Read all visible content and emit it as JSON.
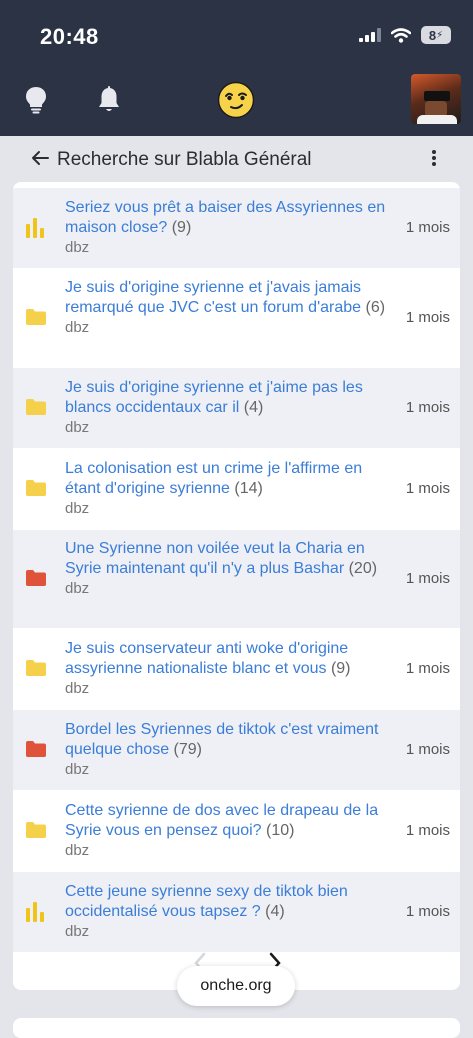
{
  "status_bar": {
    "time": "20:48",
    "battery": "8"
  },
  "app_bar": {
    "icons": [
      "lightbulb-icon",
      "bell-icon",
      "smiley-logo-icon",
      "avatar"
    ]
  },
  "header": {
    "title": "Recherche sur Blabla Général"
  },
  "topics": [
    {
      "title": "Seriez vous prêt a baiser des Assyriennes en maison close?",
      "count": "(9)",
      "author": "dbz",
      "age": "1 mois",
      "icon": "poll-icon",
      "color": "#f0c419"
    },
    {
      "title": "Je suis d'origine syrienne et j'avais jamais remarqué que JVC c'est un forum d'arabe",
      "count": "(6)",
      "author": "dbz",
      "age": "1 mois",
      "icon": "folder-icon",
      "color": "#f5d04a"
    },
    {
      "title": "Je suis d'origine syrienne et j'aime pas les blancs occidentaux car il",
      "count": "(4)",
      "author": "dbz",
      "age": "1 mois",
      "icon": "folder-icon",
      "color": "#f5d04a"
    },
    {
      "title": "La colonisation est un crime je l'affirme en étant d'origine syrienne",
      "count": "(14)",
      "author": "dbz",
      "age": "1 mois",
      "icon": "folder-icon",
      "color": "#f5d04a"
    },
    {
      "title": "Une Syrienne non voilée veut la Charia en Syrie maintenant qu'il n'y a plus Bashar",
      "count": "(20)",
      "author": "dbz",
      "age": "1 mois",
      "icon": "folder-icon",
      "color": "#e0533b"
    },
    {
      "title": "Je suis conservateur anti woke d'origine assyrienne nationaliste blanc et vous",
      "count": "(9)",
      "author": "dbz",
      "age": "1 mois",
      "icon": "folder-icon",
      "color": "#f5d04a"
    },
    {
      "title": "Bordel les Syriennes de tiktok c'est vraiment quelque chose",
      "count": "(79)",
      "author": "dbz",
      "age": "1 mois",
      "icon": "folder-icon",
      "color": "#e0533b"
    },
    {
      "title": "Cette syrienne de dos avec le drapeau de la Syrie vous en pensez quoi?",
      "count": "(10)",
      "author": "dbz",
      "age": "1 mois",
      "icon": "folder-icon",
      "color": "#f5d04a"
    },
    {
      "title": "Cette jeune syrienne sexy de tiktok bien occidentalisé vous tapsez ?",
      "count": "(4)",
      "author": "dbz",
      "age": "1 mois",
      "icon": "poll-icon",
      "color": "#f0c419"
    }
  ],
  "browser": {
    "url": "onche.org"
  }
}
